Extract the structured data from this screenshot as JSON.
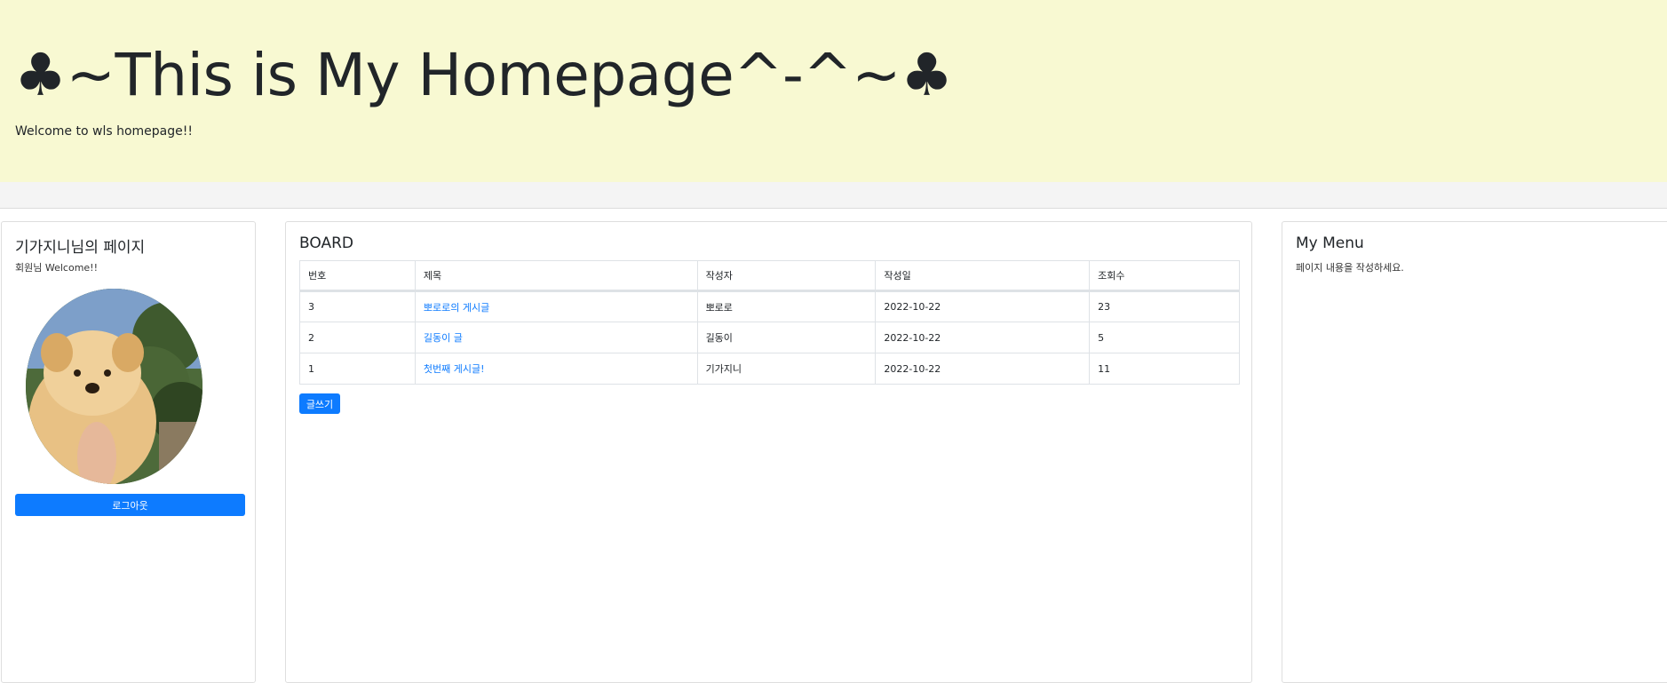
{
  "header": {
    "title": "♣~This is My Homepage^-^~♣",
    "subtitle": "Welcome to wls homepage!!"
  },
  "profile": {
    "title": "기가지니님의 페이지",
    "greeting": "회원님 Welcome!!",
    "logout_label": "로그아웃"
  },
  "board": {
    "title": "BOARD",
    "columns": [
      "번호",
      "제목",
      "작성자",
      "작성일",
      "조회수"
    ],
    "rows": [
      {
        "no": "3",
        "title": "뽀로로의 게시글",
        "author": "뽀로로",
        "date": "2022-10-22",
        "views": "23"
      },
      {
        "no": "2",
        "title": "길동이 글",
        "author": "길동이",
        "date": "2022-10-22",
        "views": "5"
      },
      {
        "no": "1",
        "title": "첫번째 게시글!",
        "author": "기가지니",
        "date": "2022-10-22",
        "views": "11"
      }
    ],
    "write_label": "글쓰기"
  },
  "menu": {
    "title": "My Menu",
    "text": "페이지 내용을 작성하세요."
  },
  "colors": {
    "header_bg": "#f8f9d2",
    "primary": "#0d7bff"
  }
}
